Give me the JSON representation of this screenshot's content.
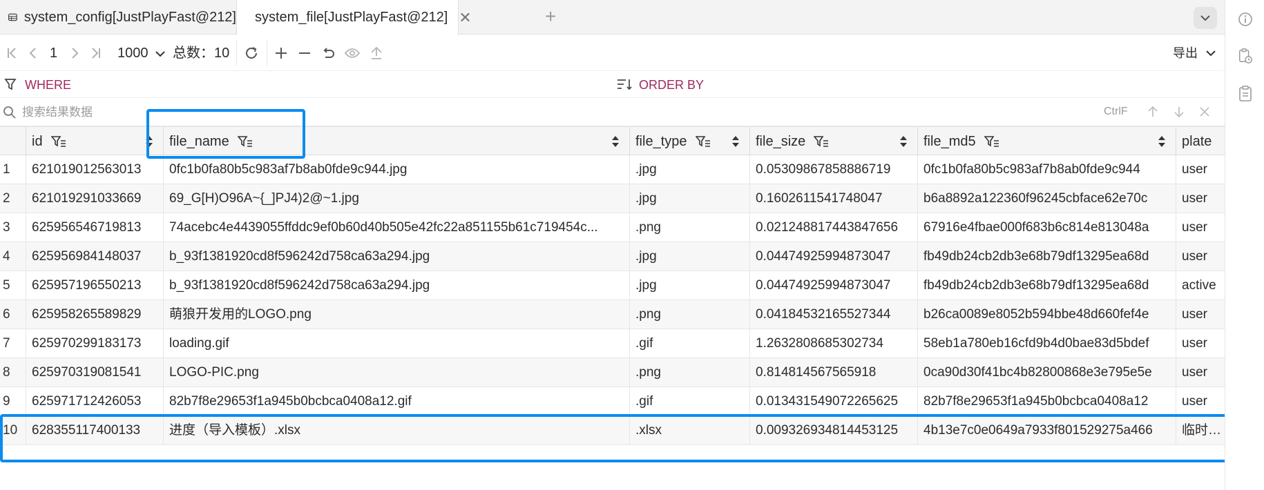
{
  "tabs": [
    {
      "label": "system_config[JustPlayFast@212]",
      "active": false
    },
    {
      "label": "system_file[JustPlayFast@212]",
      "active": true
    }
  ],
  "toolbar": {
    "page": "1",
    "page_size": "1000",
    "total_label": "总数：10",
    "export_label": "导出"
  },
  "filters": {
    "where_label": "WHERE",
    "order_label": "ORDER BY"
  },
  "search": {
    "placeholder": "搜索结果数据",
    "shortcut": "CtrlF"
  },
  "columns": [
    "id",
    "file_name",
    "file_type",
    "file_size",
    "file_md5",
    "plate"
  ],
  "rows": [
    {
      "n": "1",
      "id": "621019012563013",
      "file_name": "0fc1b0fa80b5c983af7b8ab0fde9c944.jpg",
      "file_type": ".jpg",
      "file_size": "0.05309867858886719",
      "file_md5": "0fc1b0fa80b5c983af7b8ab0fde9c944",
      "plate": "user"
    },
    {
      "n": "2",
      "id": "621019291033669",
      "file_name": "69_G[H)O96A~{_]PJ4)2@~1.jpg",
      "file_type": ".jpg",
      "file_size": "0.1602611541748047",
      "file_md5": "b6a8892a122360f96245cbface62e70c",
      "plate": "user"
    },
    {
      "n": "3",
      "id": "625956546719813",
      "file_name": "74acebc4e4439055ffddc9ef0b60d40b505e42fc22a851155b61c719454c...",
      "file_type": ".png",
      "file_size": "0.021248817443847656",
      "file_md5": "67916e4fbae000f683b6c814e813048a",
      "plate": "user"
    },
    {
      "n": "4",
      "id": "625956984148037",
      "file_name": "b_93f1381920cd8f596242d758ca63a294.jpg",
      "file_type": ".jpg",
      "file_size": "0.04474925994873047",
      "file_md5": "fb49db24cb2db3e68b79df13295ea68d",
      "plate": "user"
    },
    {
      "n": "5",
      "id": "625957196550213",
      "file_name": "b_93f1381920cd8f596242d758ca63a294.jpg",
      "file_type": ".jpg",
      "file_size": "0.04474925994873047",
      "file_md5": "fb49db24cb2db3e68b79df13295ea68d",
      "plate": "active"
    },
    {
      "n": "6",
      "id": "625958265589829",
      "file_name": "萌狼开发用的LOGO.png",
      "file_type": ".png",
      "file_size": "0.04184532165527344",
      "file_md5": "b26ca0089e8052b594bbe48d660fef4e",
      "plate": "user"
    },
    {
      "n": "7",
      "id": "625970299183173",
      "file_name": "loading.gif",
      "file_type": ".gif",
      "file_size": "1.2632808685302734",
      "file_md5": "58eb1a780eb16cfd9b4d0bae83d5bdef",
      "plate": "user"
    },
    {
      "n": "8",
      "id": "625970319081541",
      "file_name": "LOGO-PIC.png",
      "file_type": ".png",
      "file_size": "0.814814567565918",
      "file_md5": "0ca90d30f41bc4b82800868e3e795e5e",
      "plate": "user"
    },
    {
      "n": "9",
      "id": "625971712426053",
      "file_name": "82b7f8e29653f1a945b0bcbca0408a12.gif",
      "file_type": ".gif",
      "file_size": "0.013431549072265625",
      "file_md5": "82b7f8e29653f1a945b0bcbca0408a12",
      "plate": "user"
    },
    {
      "n": "10",
      "id": "628355117400133",
      "file_name": "进度（导入模板）.xlsx",
      "file_type": ".xlsx",
      "file_size": "0.009326934814453125",
      "file_md5": "4b13e7c0e0649a7933f801529275a466",
      "plate": "临时文件"
    }
  ],
  "colors": {
    "accent": "#0a8cf0",
    "filter_label": "#a0285c"
  }
}
